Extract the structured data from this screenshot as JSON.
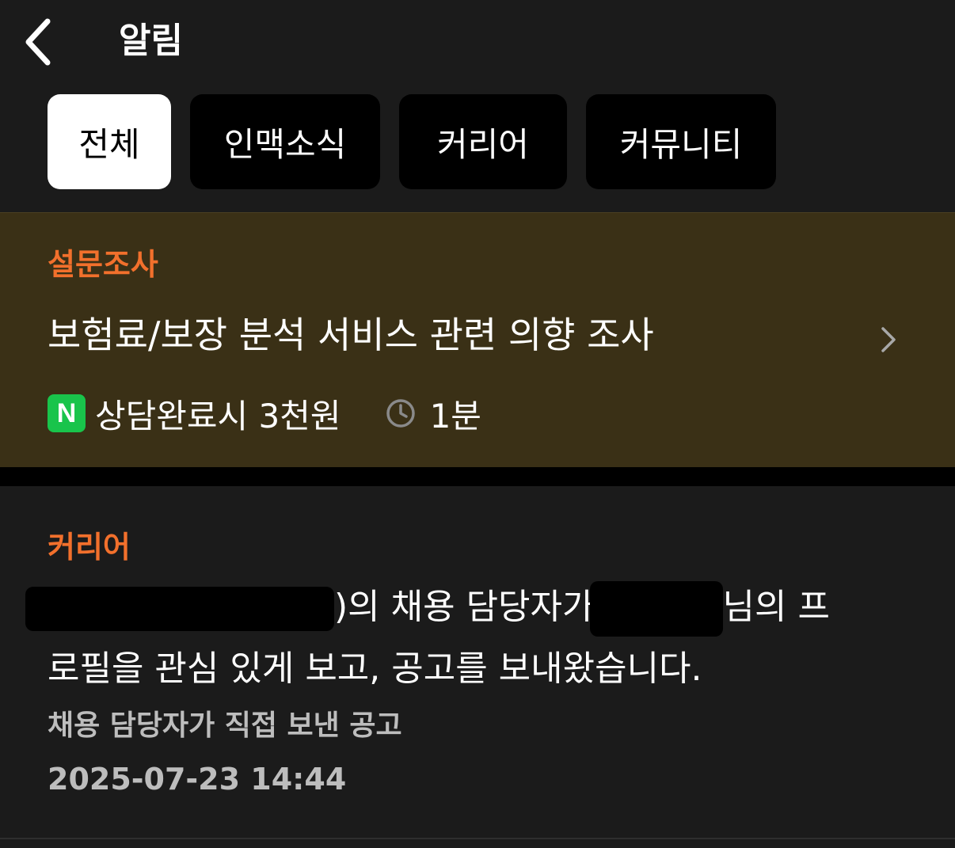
{
  "header": {
    "title": "알림",
    "back_icon": "chevron-left-icon"
  },
  "tabs": [
    {
      "label": "전체",
      "active": true
    },
    {
      "label": "인맥소식",
      "active": false
    },
    {
      "label": "커리어",
      "active": false
    },
    {
      "label": "커뮤니티",
      "active": false
    }
  ],
  "survey": {
    "category": "설문조사",
    "title": "보험료/보장 분석 서비스 관련 의향 조사",
    "badge_letter": "N",
    "reward": "상담완료시 3천원",
    "duration": "1분",
    "colors": {
      "background": "#3a3016",
      "category": "#f2702c",
      "badge": "#19c44b"
    }
  },
  "career": {
    "category": "커리어",
    "message_part1": ")의 채용 담당자가",
    "message_part2": "님의 프",
    "message_line2": "로필을 관심 있게 보고, 공고를 보내왔습니다.",
    "subtitle": "채용 담당자가 직접 보낸 공고",
    "timestamp": "2025-07-23 14:44"
  }
}
